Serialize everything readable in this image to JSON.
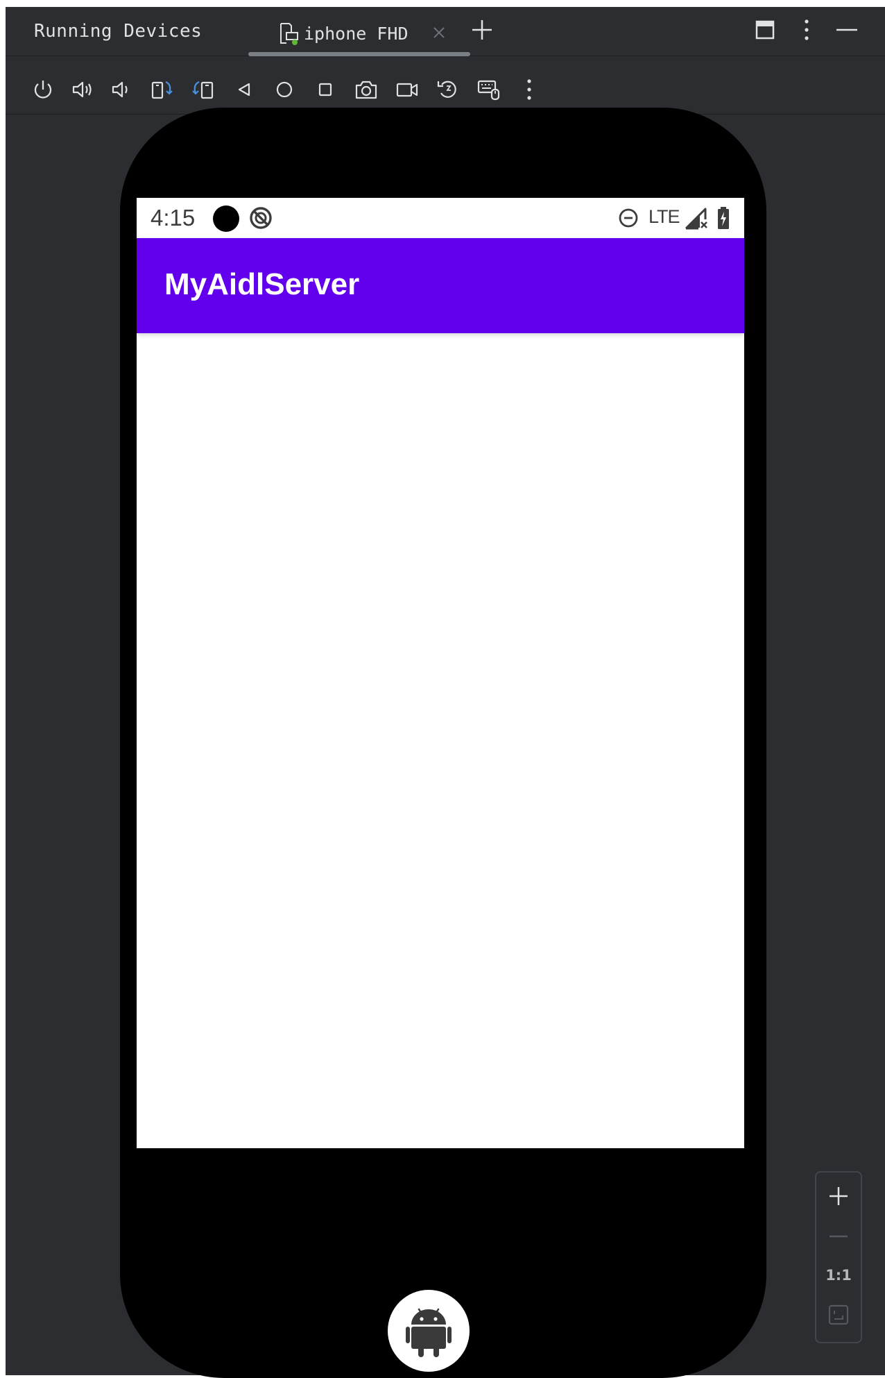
{
  "panel": {
    "title": "Running Devices"
  },
  "tabs": [
    {
      "label": "iphone FHD",
      "active": true
    }
  ],
  "toolbar": {
    "buttons": [
      "power-icon",
      "volume-up-icon",
      "volume-down-icon",
      "rotate-left-icon",
      "rotate-right-icon",
      "back-icon",
      "home-icon",
      "overview-icon",
      "screenshot-icon",
      "screen-record-icon",
      "reset-icon",
      "keyboard-mouse-icon",
      "more-vert-icon"
    ]
  },
  "device": {
    "status_bar": {
      "time": "4:15",
      "network": "LTE"
    },
    "app_bar": {
      "title": "MyAidlServer",
      "color": "#6200ee"
    }
  },
  "zoom": {
    "actual_size_label": "1:1"
  },
  "colors": {
    "ide_background": "#2b2d30",
    "icon": "#dfe1e5",
    "accent": "#6200ee"
  }
}
